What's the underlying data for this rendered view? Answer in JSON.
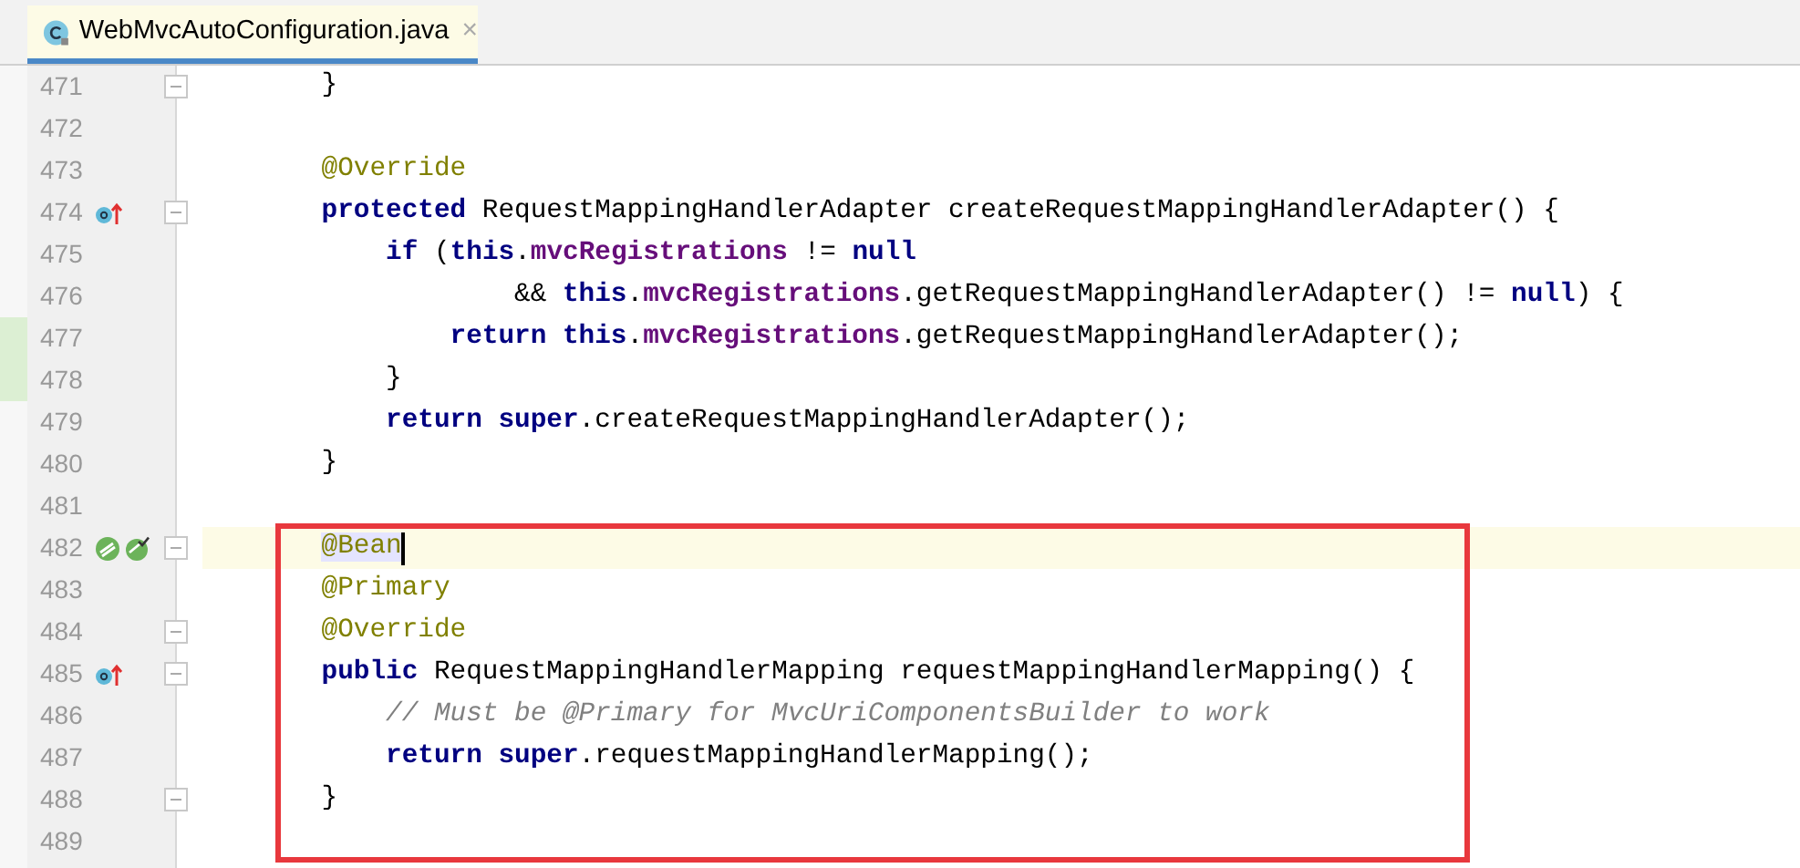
{
  "tab": {
    "label": "WebMvcAutoConfiguration.java",
    "selected": true,
    "close": "×"
  },
  "lines": [
    {
      "number": "471",
      "fold": true,
      "tokens": [
        {
          "kind": "plain",
          "text": "    }"
        }
      ]
    },
    {
      "number": "472"
    },
    {
      "number": "473",
      "tokens": [
        {
          "kind": "annotation",
          "text": "    @Override"
        }
      ]
    },
    {
      "number": "474",
      "overrides": true,
      "fold": true,
      "tokens": [
        {
          "kind": "keyword",
          "text": "    protected"
        },
        {
          "kind": "plain",
          "text": " RequestMappingHandlerAdapter createRequestMappingHandlerAdapter() {"
        }
      ]
    },
    {
      "number": "475",
      "tokens": [
        {
          "kind": "keyword",
          "text": "        if"
        },
        {
          "kind": "plain",
          "text": " ("
        },
        {
          "kind": "keyword",
          "text": "this"
        },
        {
          "kind": "plain",
          "text": "."
        },
        {
          "kind": "field",
          "text": "mvcRegistrations"
        },
        {
          "kind": "plain",
          "text": " != "
        },
        {
          "kind": "keyword",
          "text": "null"
        }
      ]
    },
    {
      "number": "476",
      "tokens": [
        {
          "kind": "plain",
          "text": "                && "
        },
        {
          "kind": "keyword",
          "text": "this"
        },
        {
          "kind": "plain",
          "text": "."
        },
        {
          "kind": "field",
          "text": "mvcRegistrations"
        },
        {
          "kind": "plain",
          "text": ".getRequestMappingHandlerAdapter() != "
        },
        {
          "kind": "keyword",
          "text": "null"
        },
        {
          "kind": "plain",
          "text": ") {"
        }
      ]
    },
    {
      "number": "477",
      "changed": true,
      "tokens": [
        {
          "kind": "keyword",
          "text": "            return this"
        },
        {
          "kind": "plain",
          "text": "."
        },
        {
          "kind": "field",
          "text": "mvcRegistrations"
        },
        {
          "kind": "plain",
          "text": ".getRequestMappingHandlerAdapter();"
        }
      ]
    },
    {
      "number": "478",
      "changed": true,
      "tokens": [
        {
          "kind": "plain",
          "text": "        }"
        }
      ]
    },
    {
      "number": "479",
      "tokens": [
        {
          "kind": "keyword",
          "text": "        return super"
        },
        {
          "kind": "plain",
          "text": ".createRequestMappingHandlerAdapter();"
        }
      ]
    },
    {
      "number": "480",
      "tokens": [
        {
          "kind": "plain",
          "text": "    }"
        }
      ]
    },
    {
      "number": "481"
    }
  ],
  "highlight_frame": {
    "lines": [
      {
        "number": "482",
        "bean": true,
        "fold": true,
        "current": true,
        "tokens": [
          {
            "kind": "annotation",
            "text": "    @Bean",
            "highlighted": true
          }
        ]
      },
      {
        "number": "483",
        "tokens": [
          {
            "kind": "annotation",
            "text": "    @Primary"
          }
        ]
      },
      {
        "number": "484",
        "fold": true,
        "tokens": [
          {
            "kind": "annotation",
            "text": "    @Override"
          }
        ]
      },
      {
        "number": "485",
        "overrides": true,
        "fold": true,
        "tokens": [
          {
            "kind": "keyword",
            "text": "    public"
          },
          {
            "kind": "plain",
            "text": " RequestMappingHandlerMapping requestMappingHandlerMapping() {"
          }
        ]
      },
      {
        "number": "486",
        "tokens": [
          {
            "kind": "comment",
            "text": "        // Must be @Primary for MvcUriComponentsBuilder to work"
          }
        ]
      },
      {
        "number": "487",
        "tokens": [
          {
            "kind": "keyword",
            "text": "        return super"
          },
          {
            "kind": "plain",
            "text": ".requestMappingHandlerMapping();"
          }
        ]
      },
      {
        "number": "488",
        "fold": true,
        "tokens": [
          {
            "kind": "plain",
            "text": "    }"
          }
        ]
      },
      {
        "number": "489"
      }
    ]
  }
}
